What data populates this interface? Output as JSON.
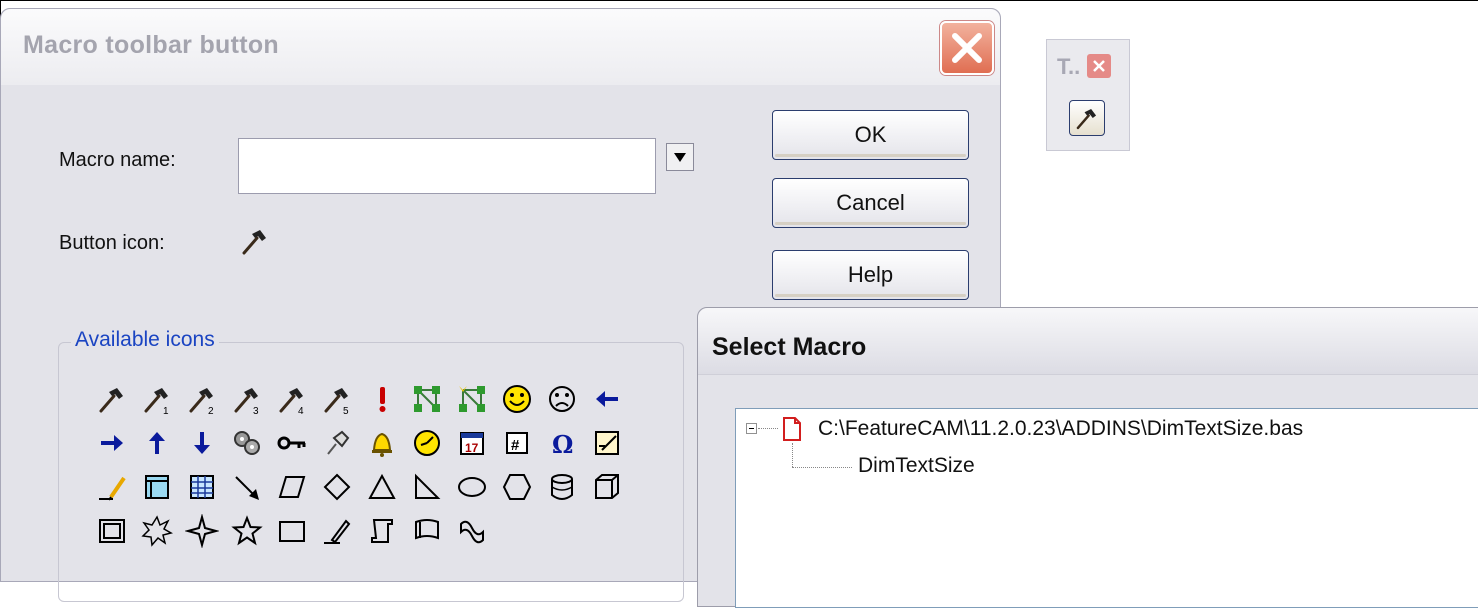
{
  "dialog": {
    "title": "Macro toolbar button",
    "macro_name_label": "Macro name:",
    "macro_name_value": "",
    "button_icon_label": "Button icon:",
    "ok_label": "OK",
    "cancel_label": "Cancel",
    "help_label": "Help",
    "available_icons_label": "Available icons",
    "icons": [
      "hammer-icon",
      "hammer-1-icon",
      "hammer-2-icon",
      "hammer-3-icon",
      "hammer-4-icon",
      "hammer-5-icon",
      "exclamation-icon",
      "network-icon",
      "network-spark-icon",
      "smiley-icon",
      "frown-icon",
      "arrow-left-icon",
      "arrow-right-icon",
      "arrow-up-icon",
      "arrow-down-icon",
      "gears-icon",
      "key-icon",
      "pushpin-icon",
      "bell-icon",
      "clock-icon",
      "calendar-icon",
      "hash-icon",
      "omega-icon",
      "edit-box-icon",
      "pencil-icon",
      "window-icon",
      "table-icon",
      "line-arrow-icon",
      "parallelogram-icon",
      "diamond-icon",
      "triangle-icon",
      "right-triangle-icon",
      "ellipse-icon",
      "hexagon-icon",
      "cylinder-icon",
      "cube-icon",
      "frame-icon",
      "burst-icon",
      "star4-icon",
      "star5-icon",
      "rectangle-icon",
      "pen-icon",
      "scroll-icon",
      "flag-icon",
      "wave-icon"
    ]
  },
  "toolbar_window": {
    "title": "T.."
  },
  "select_macro": {
    "title": "Select Macro",
    "file_path": "C:\\FeatureCAM\\11.2.0.23\\ADDINS\\DimTextSize.bas",
    "macro_item": "DimTextSize"
  },
  "colors": {
    "dialog_bg": "#e3e3e9",
    "group_label": "#1a44c2",
    "arrow_blue": "#0a1a9c",
    "close_red": "#e06e52"
  }
}
